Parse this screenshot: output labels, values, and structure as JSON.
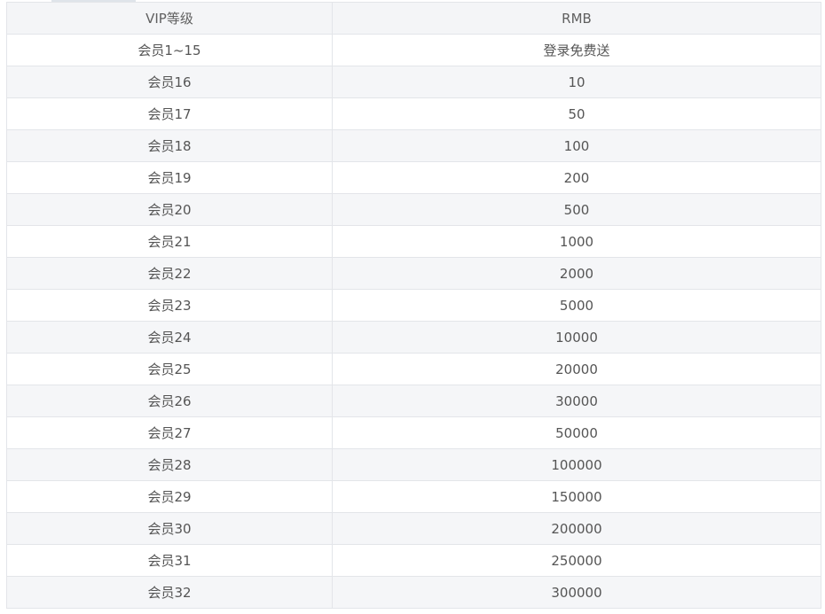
{
  "table": {
    "headers": [
      "VIP等级",
      "RMB"
    ],
    "rows": [
      [
        "会员1~15",
        "登录免费送"
      ],
      [
        "会员16",
        "10"
      ],
      [
        "会员17",
        "50"
      ],
      [
        "会员18",
        "100"
      ],
      [
        "会员19",
        "200"
      ],
      [
        "会员20",
        "500"
      ],
      [
        "会员21",
        "1000"
      ],
      [
        "会员22",
        "2000"
      ],
      [
        "会员23",
        "5000"
      ],
      [
        "会员24",
        "10000"
      ],
      [
        "会员25",
        "20000"
      ],
      [
        "会员26",
        "30000"
      ],
      [
        "会员27",
        "50000"
      ],
      [
        "会员28",
        "100000"
      ],
      [
        "会员29",
        "150000"
      ],
      [
        "会员30",
        "200000"
      ],
      [
        "会员31",
        "250000"
      ],
      [
        "会员32",
        "300000"
      ]
    ]
  },
  "colors": {
    "header_bg": "#f4f5f7",
    "row_even_bg": "#f5f6f8",
    "row_odd_bg": "#ffffff",
    "border": "#e3e5e9",
    "text": "#555555"
  }
}
